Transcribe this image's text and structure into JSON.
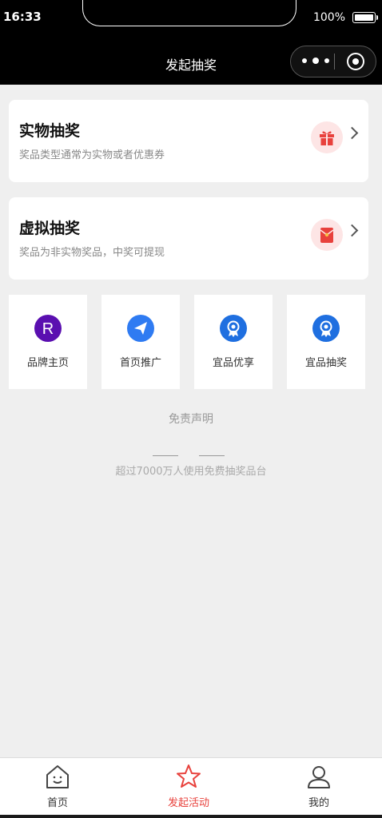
{
  "status_bar": {
    "time": "16:33",
    "battery": "100%"
  },
  "nav": {
    "title": "发起抽奖"
  },
  "cards": [
    {
      "title": "实物抽奖",
      "subtitle": "奖品类型通常为实物或者优惠券",
      "icon": "gift-icon"
    },
    {
      "title": "虚拟抽奖",
      "subtitle": "奖品为非实物奖品，中奖可提现",
      "icon": "red-envelope-icon"
    }
  ],
  "tiles": [
    {
      "label": "品牌主页",
      "icon": "brand-r-icon",
      "color": "#5a0fb0"
    },
    {
      "label": "首页推广",
      "icon": "paper-plane-icon",
      "color": "#2f7bf2"
    },
    {
      "label": "宜品优享",
      "icon": "badge-icon",
      "color": "#1f6fe0"
    },
    {
      "label": "宜品抽奖",
      "icon": "badge-icon",
      "color": "#1f6fe0"
    }
  ],
  "disclaimer": "免责声明",
  "footer_text": "超过7000万人使用免费抽奖品台",
  "tabbar": [
    {
      "label": "首页",
      "icon": "home-icon"
    },
    {
      "label": "发起活动",
      "icon": "star-icon",
      "active": true
    },
    {
      "label": "我的",
      "icon": "user-icon"
    }
  ],
  "colors": {
    "accent": "#e8413c",
    "background": "#efefef"
  }
}
